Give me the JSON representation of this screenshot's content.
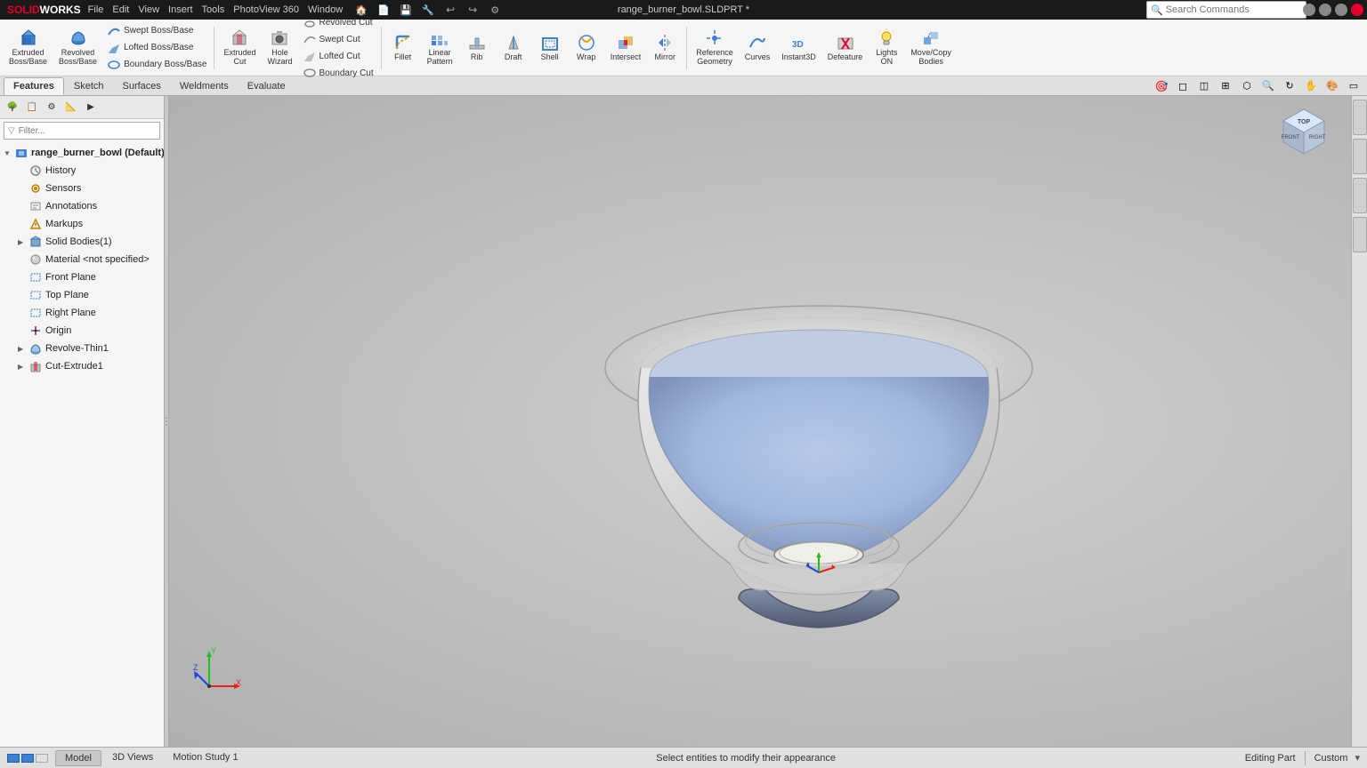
{
  "titlebar": {
    "logo": "SOLID",
    "logo2": "WORKS",
    "menu": [
      "File",
      "Edit",
      "View",
      "Insert",
      "Tools",
      "PhotoView 360",
      "Window"
    ],
    "title": "range_burner_bowl.SLDPRT *",
    "search_placeholder": "Search Commands"
  },
  "ribbon": {
    "tabs": [
      "Features",
      "Sketch",
      "Surfaces",
      "Weldments",
      "Evaluate"
    ]
  },
  "toolbar": {
    "groups": [
      {
        "items": [
          {
            "label": "Extruded\nBoss/Base",
            "icon": "cube"
          },
          {
            "label": "Revolved\nBoss/Base",
            "icon": "revolve"
          },
          {
            "label": "Swept Boss/Base",
            "icon": "sweep"
          },
          {
            "label": "Lofted Boss/Base",
            "icon": "loft"
          },
          {
            "label": "Boundary Boss/Base",
            "icon": "boundary"
          }
        ]
      },
      {
        "items": [
          {
            "label": "Extruded\nCut",
            "icon": "extrude-cut"
          },
          {
            "label": "Hole\nWizard",
            "icon": "hole"
          },
          {
            "label": "Revolved\nCut",
            "icon": "revolve-cut"
          },
          {
            "label": "Swept Cut",
            "icon": "swept-cut"
          },
          {
            "label": "Lofted Cut",
            "icon": "lofted-cut"
          },
          {
            "label": "Boundary Cut",
            "icon": "boundary-cut"
          }
        ]
      },
      {
        "items": [
          {
            "label": "Fillet",
            "icon": "fillet"
          },
          {
            "label": "Linear\nPattern",
            "icon": "pattern"
          },
          {
            "label": "Rib",
            "icon": "rib"
          },
          {
            "label": "Draft",
            "icon": "draft"
          },
          {
            "label": "Shell",
            "icon": "shell"
          },
          {
            "label": "Wrap",
            "icon": "wrap"
          },
          {
            "label": "Intersect",
            "icon": "intersect"
          },
          {
            "label": "Mirror",
            "icon": "mirror"
          }
        ]
      },
      {
        "items": [
          {
            "label": "Reference\nGeometry",
            "icon": "ref-geom"
          },
          {
            "label": "Curves",
            "icon": "curves"
          },
          {
            "label": "Instant3D",
            "icon": "instant3d"
          },
          {
            "label": "Defeature",
            "icon": "defeature"
          },
          {
            "label": "Lights\nON",
            "icon": "lights"
          },
          {
            "label": "Move/Copy\nBodies",
            "icon": "move-copy"
          }
        ]
      }
    ]
  },
  "feature_tree": {
    "root": "range_burner_bowl (Default) <<Default>",
    "items": [
      {
        "label": "History",
        "icon": "history",
        "expandable": false,
        "indent": 1
      },
      {
        "label": "Sensors",
        "icon": "sensor",
        "expandable": false,
        "indent": 1
      },
      {
        "label": "Annotations",
        "icon": "annotation",
        "expandable": false,
        "indent": 1
      },
      {
        "label": "Markups",
        "icon": "markup",
        "expandable": false,
        "indent": 1
      },
      {
        "label": "Solid Bodies(1)",
        "icon": "solid",
        "expandable": true,
        "indent": 1
      },
      {
        "label": "Material <not specified>",
        "icon": "material",
        "expandable": false,
        "indent": 1
      },
      {
        "label": "Front Plane",
        "icon": "plane",
        "expandable": false,
        "indent": 1
      },
      {
        "label": "Top Plane",
        "icon": "plane",
        "expandable": false,
        "indent": 1
      },
      {
        "label": "Right Plane",
        "icon": "plane",
        "expandable": false,
        "indent": 1
      },
      {
        "label": "Origin",
        "icon": "origin",
        "expandable": false,
        "indent": 1
      },
      {
        "label": "Revolve-Thin1",
        "icon": "revolve",
        "expandable": true,
        "indent": 1
      },
      {
        "label": "Cut-Extrude1",
        "icon": "cut-extrude",
        "expandable": true,
        "indent": 1
      }
    ]
  },
  "statusbar": {
    "message": "Select entities to modify their appearance",
    "tabs": [
      "Model",
      "3D Views",
      "Motion Study 1"
    ],
    "active_tab": "Model",
    "editing": "Editing Part",
    "custom": "Custom"
  },
  "viewport": {
    "bg_color_center": "#d8d8d8",
    "bg_color_edge": "#b0b0b0"
  }
}
